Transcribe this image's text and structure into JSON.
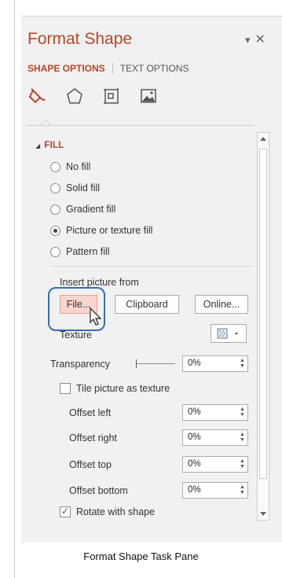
{
  "pane": {
    "title": "Format Shape",
    "tabs": [
      "SHAPE OPTIONS",
      "TEXT OPTIONS"
    ],
    "icons": [
      "fill-line-icon",
      "effects-icon",
      "size-properties-icon",
      "picture-icon"
    ]
  },
  "fill": {
    "header": "FILL",
    "options": [
      {
        "label": "No fill",
        "selected": false
      },
      {
        "label": "Solid fill",
        "selected": false
      },
      {
        "label": "Gradient fill",
        "selected": false
      },
      {
        "label": "Picture or texture fill",
        "selected": true
      },
      {
        "label": "Pattern fill",
        "selected": false
      }
    ],
    "insert_label": "Insert picture from",
    "buttons": {
      "file": "File...",
      "clipboard": "Clipboard",
      "online": "Online..."
    },
    "texture_label": "Texture",
    "transparency_label": "Transparency",
    "transparency_value": "0%",
    "tile_label": "Tile picture as texture",
    "tile_checked": false,
    "offsets": [
      {
        "label": "Offset left",
        "value": "0%"
      },
      {
        "label": "Offset right",
        "value": "0%"
      },
      {
        "label": "Offset top",
        "value": "0%"
      },
      {
        "label": "Offset bottom",
        "value": "0%"
      }
    ],
    "rotate_label": "Rotate with shape",
    "rotate_checked": true
  },
  "caption": "Format Shape Task Pane",
  "colors": {
    "accent": "#b7472a",
    "highlight": "#3669c2"
  }
}
